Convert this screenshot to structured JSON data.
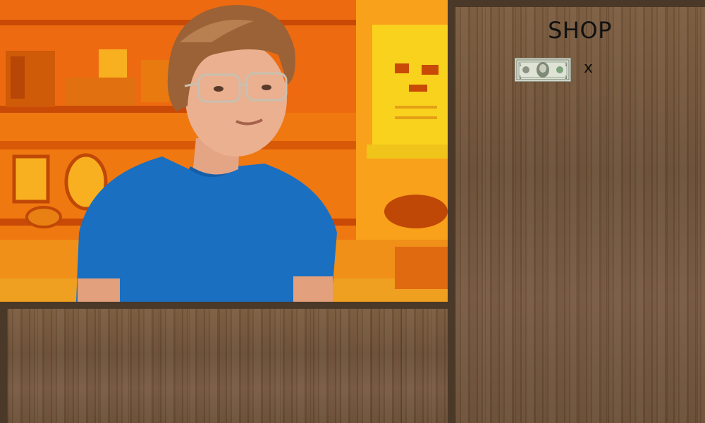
{
  "shop": {
    "title": "SHOP",
    "item": {
      "icon": "dollar-bill-icon",
      "quantity_label": "x"
    }
  },
  "scene": {
    "description_icon": "character-portrait",
    "palette": {
      "background": "#f07c10",
      "shirt": "#1a6fc0"
    }
  },
  "colors": {
    "panel_border": "#4a3828",
    "wood": "#6e5238"
  }
}
